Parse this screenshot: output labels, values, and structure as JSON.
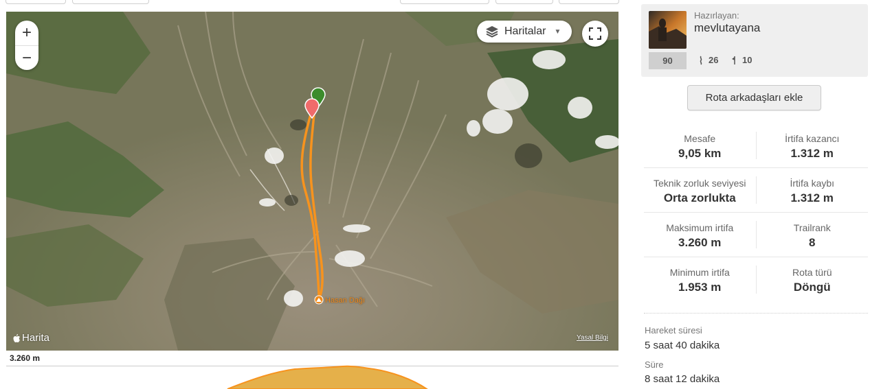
{
  "map": {
    "layers_label": "Haritalar",
    "zoom_in": "+",
    "zoom_out": "−",
    "brand": "Harita",
    "legal": "Yasal Bilgi",
    "peak_name": "Hasan Dağı"
  },
  "elevation": {
    "max_label": "3.260 m"
  },
  "author": {
    "caption": "Hazırlayan:",
    "name": "mevlutayana",
    "score": "90",
    "followers": "26",
    "trails": "10"
  },
  "add_companions_label": "Rota arkadaşları ekle",
  "stats": [
    {
      "left_title": "Mesafe",
      "left_value": "9,05 km",
      "right_title": "İrtifa kazancı",
      "right_value": "1.312 m"
    },
    {
      "left_title": "Teknik zorluk seviyesi",
      "left_value": "Orta zorlukta",
      "right_title": "İrtifa kaybı",
      "right_value": "1.312 m"
    },
    {
      "left_title": "Maksimum irtifa",
      "left_value": "3.260 m",
      "right_title": "Trailrank",
      "right_value": "8"
    },
    {
      "left_title": "Minimum irtifa",
      "left_value": "1.953 m",
      "right_title": "Rota türü",
      "right_value": "Döngü"
    }
  ],
  "moving_time": {
    "label": "Hareket süresi",
    "value": "5 saat 40 dakika"
  },
  "total_time": {
    "label": "Süre",
    "value": "8 saat 12 dakika"
  },
  "colors": {
    "route": "#f7931e",
    "start_marker": "#3c8c2c",
    "end_marker": "#f06b6b",
    "elevation_fill": "#e5b04a"
  }
}
